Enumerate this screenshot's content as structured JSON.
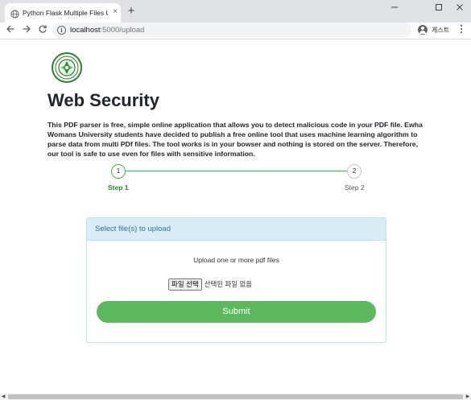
{
  "browser": {
    "tab_title": "Python Flask Multiple Files Upload",
    "tab_close": "×",
    "new_tab": "+",
    "url_host": "localhost",
    "url_path": ":5000/upload",
    "profile_label": "게스트",
    "window_controls": [
      "minimize-icon",
      "maximize-icon",
      "close-icon"
    ]
  },
  "page": {
    "logo": "university-seal",
    "title": "Web Security",
    "description": "This PDF parser is free, simple online application that allows you to detect malicious code in your PDF file. Ewha Womans University students have decided to publish a free online tool that uses machine learning algorithm to parse data from multi PDf files. The tool works is in your bowser and nothing is stored on the server. Therefore, our tool is safe to use even for files with sensitive information."
  },
  "stepper": {
    "steps": [
      {
        "number": "1",
        "label": "Step 1",
        "active": true
      },
      {
        "number": "2",
        "label": "Step 2",
        "active": false
      }
    ],
    "colors": {
      "active": "#4caf50",
      "inactive": "#c8c8c8"
    }
  },
  "upload": {
    "header": "Select file(s) to upload",
    "hint": "Upload one or more pdf files",
    "file_button": "파일 선택",
    "file_status": "선택된 파일 없음",
    "submit_label": "Submit",
    "colors": {
      "header_bg": "#d9edf7",
      "submit_bg": "#5cb85c"
    }
  }
}
